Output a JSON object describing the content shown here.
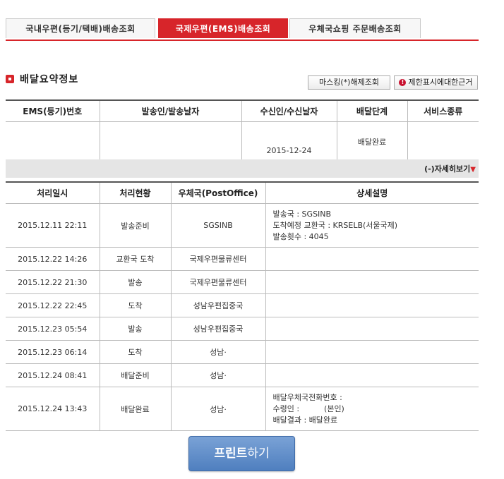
{
  "tabs": [
    {
      "label": "국내우편(등기/택배)배송조회",
      "active": false
    },
    {
      "label": "국제우편(EMS)배송조회",
      "active": true
    },
    {
      "label": "우체국쇼핑 주문배송조회",
      "active": false
    }
  ],
  "section_title": "배달요약정보",
  "buttons": {
    "mask": "마스킹(*)해제조회",
    "limit": "제한표시에대한근거",
    "print_strong": "프린트",
    "print_rest": "하기"
  },
  "summary": {
    "headers": [
      "EMS(등기)번호",
      "발송인/발송날자",
      "수신인/수신날자",
      "배달단계",
      "서비스종류"
    ],
    "row": [
      "",
      "",
      "2015-12-24",
      "배달완료",
      ""
    ]
  },
  "detail_toggle": "(-)자세히보기",
  "detail": {
    "headers": [
      "처리일시",
      "처리현황",
      "우체국(PostOffice)",
      "상세설명"
    ],
    "rows": [
      {
        "datetime": "2015.12.11 22:11",
        "status": "발송준비",
        "office": "SGSINB",
        "desc": [
          "발송국 : SGSINB",
          "도착예정 교환국 : KRSELB(서울국제)",
          "발송횟수 : 4045"
        ]
      },
      {
        "datetime": "2015.12.22 14:26",
        "status": "교환국 도착",
        "office": "국제우편물류센터",
        "desc": []
      },
      {
        "datetime": "2015.12.22 21:30",
        "status": "발송",
        "office": "국제우편물류센터",
        "desc": []
      },
      {
        "datetime": "2015.12.22 22:45",
        "status": "도착",
        "office": "성남우편집중국",
        "desc": []
      },
      {
        "datetime": "2015.12.23 05:54",
        "status": "발송",
        "office": "성남우편집중국",
        "desc": []
      },
      {
        "datetime": "2015.12.23 06:14",
        "status": "도착",
        "office": "성남·",
        "desc": []
      },
      {
        "datetime": "2015.12.24 08:41",
        "status": "배달준비",
        "office": "성남·",
        "desc": []
      },
      {
        "datetime": "2015.12.24 13:43",
        "status": "배달완료",
        "office": "성남·",
        "desc": [
          "배달우체국전화번호 :",
          "수령인 :          (본인)",
          "배달결과 : 배달완료"
        ]
      }
    ]
  }
}
